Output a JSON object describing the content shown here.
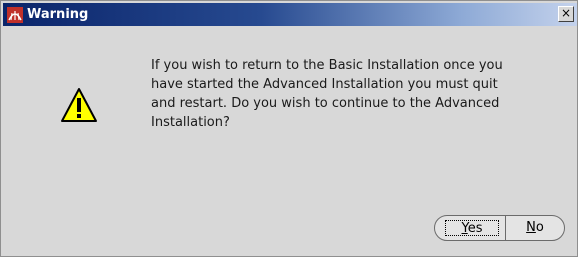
{
  "window": {
    "title": "Warning",
    "close_label": "×"
  },
  "icons": {
    "title_icon": "oracle-logo-icon",
    "message_icon": "warning-triangle-icon"
  },
  "message": {
    "text": "If you wish to return to the Basic Installation once you\nhave started the Advanced Installation you must quit\nand restart. Do you wish to continue to the Advanced\nInstallation?"
  },
  "buttons": {
    "yes": {
      "mnemonic": "Y",
      "rest": "es"
    },
    "no": {
      "mnemonic": "N",
      "rest": "o"
    }
  },
  "colors": {
    "titlebar_start": "#0a246a",
    "titlebar_end": "#c4d2ec",
    "dialog_background": "#d8d8d8",
    "warning_yellow": "#ffff00"
  }
}
